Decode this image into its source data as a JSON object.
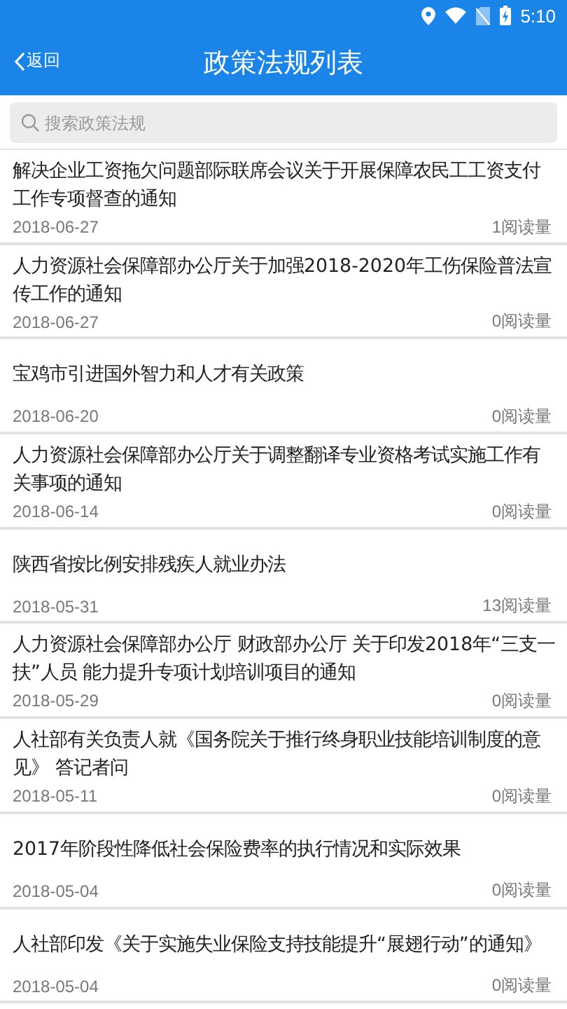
{
  "status_bar": {
    "time": "5:10"
  },
  "header": {
    "back": "返回",
    "title": "政策法规列表"
  },
  "search": {
    "placeholder": "搜索政策法规"
  },
  "articles": [
    {
      "title": "解决企业工资拖欠问题部际联席会议关于开展保障农民工工资支付工作专项督查的通知",
      "date": "2018-06-27",
      "reads": "1阅读量"
    },
    {
      "title": "人力资源社会保障部办公厅关于加强2018-2020年工伤保险普法宣传工作的通知",
      "date": "2018-06-27",
      "reads": "0阅读量"
    },
    {
      "title": "宝鸡市引进国外智力和人才有关政策",
      "date": "2018-06-20",
      "reads": "0阅读量"
    },
    {
      "title": "人力资源社会保障部办公厅关于调整翻译专业资格考试实施工作有关事项的通知",
      "date": "2018-06-14",
      "reads": "0阅读量"
    },
    {
      "title": "陕西省按比例安排残疾人就业办法",
      "date": "2018-05-31",
      "reads": "13阅读量"
    },
    {
      "title": "人力资源社会保障部办公厅 财政部办公厅 关于印发2018年“三支一扶”人员 能力提升专项计划培训项目的通知",
      "date": "2018-05-29",
      "reads": "0阅读量"
    },
    {
      "title": "人社部有关负责人就《国务院关于推行终身职业技能培训制度的意见》 答记者问",
      "date": "2018-05-11",
      "reads": "0阅读量"
    },
    {
      "title": "2017年阶段性降低社会保险费率的执行情况和实际效果",
      "date": "2018-05-04",
      "reads": "0阅读量"
    },
    {
      "title": "人社部印发《关于实施失业保险支持技能提升“展翅行动”的通知》",
      "date": "2018-05-04",
      "reads": "0阅读量"
    }
  ]
}
